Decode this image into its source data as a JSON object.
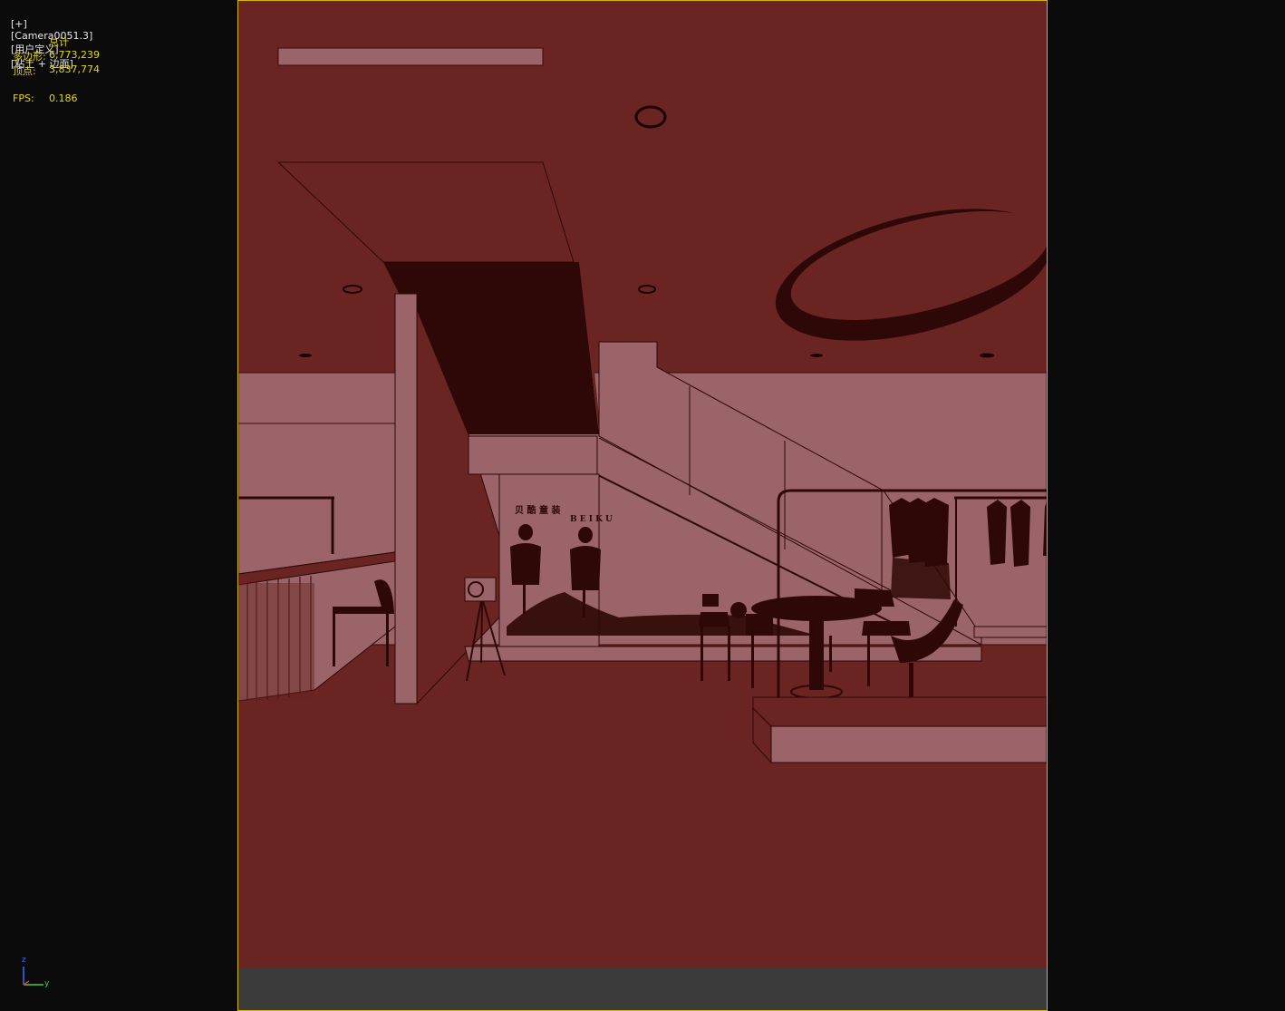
{
  "viewport": {
    "label_parts": [
      "[+]",
      "[Camera0051.3]",
      "[用户定义]",
      "[粘土 + 边面]"
    ]
  },
  "stats": {
    "header": "总计",
    "polygons_label": "多边形:",
    "polygons_value": "6,773,239",
    "vertices_label": "顶点:",
    "vertices_value": "3,837,774",
    "fps_label": "FPS:",
    "fps_value": "0.186"
  },
  "scene": {
    "signage_cn": "贝 酷 童 装",
    "signage_en": "B E I K U"
  },
  "axis": {
    "z": "z",
    "y": "y"
  },
  "colors": {
    "background": "#0b0b0b",
    "viewport_border": "#d4b800",
    "stats_text": "#e8d700",
    "clay_base": "#6a2422",
    "clay_light": "#9a6468",
    "clay_dark": "#2e0806"
  }
}
